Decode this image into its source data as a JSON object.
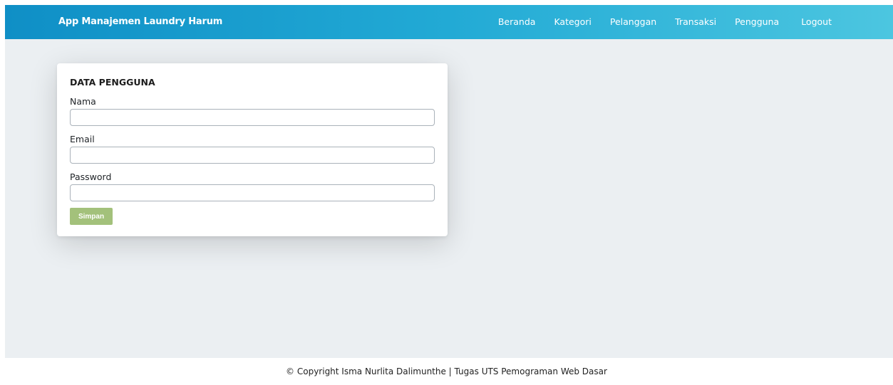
{
  "navbar": {
    "brand": "App Manajemen Laundry Harum",
    "items": [
      "Beranda",
      "Kategori",
      "Pelanggan",
      "Transaksi",
      "Pengguna",
      "Logout"
    ]
  },
  "form": {
    "title": "DATA PENGGUNA",
    "fields": [
      {
        "label": "Nama",
        "value": "",
        "placeholder": ""
      },
      {
        "label": "Email",
        "value": "",
        "placeholder": ""
      },
      {
        "label": "Password",
        "value": "",
        "placeholder": ""
      }
    ],
    "submit_label": "Simpan"
  },
  "footer": {
    "text": "© Copyright Isma Nurlita Dalimunthe | Tugas UTS Pemograman Web Dasar"
  },
  "colors": {
    "navbar_start": "#0f8fc6",
    "navbar_end": "#4cc6e0",
    "page_background": "#ebeff2",
    "button": "#a3c17b"
  }
}
